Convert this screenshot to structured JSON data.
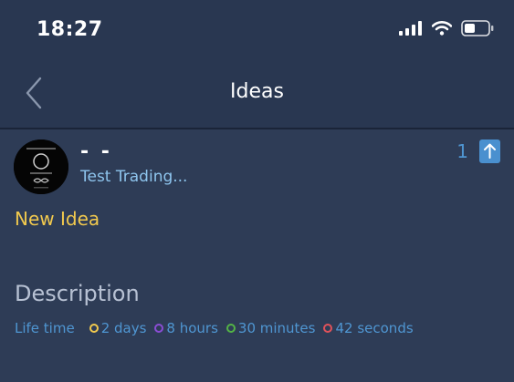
{
  "status_bar": {
    "time": "18:27",
    "icons": [
      "cellular-signal-icon",
      "wifi-icon",
      "battery-icon"
    ]
  },
  "nav": {
    "title": "Ideas",
    "back_icon": "chevron-left-icon"
  },
  "idea": {
    "author_name": "- -",
    "author_subtitle": "Test Trading...",
    "vote_count": "1",
    "upvote_icon": "arrow-up-icon",
    "title": "New Idea",
    "description_heading": "Description",
    "lifetime": {
      "label": "Life time",
      "segments": [
        {
          "value": "2 days",
          "color": "#f1c94e"
        },
        {
          "value": "8 hours",
          "color": "#8a4dd4"
        },
        {
          "value": "30 minutes",
          "color": "#53b346"
        },
        {
          "value": "42 seconds",
          "color": "#e0525a"
        }
      ]
    }
  },
  "colors": {
    "background": "#2e3c56",
    "header": "#293751",
    "accent_blue": "#4f96d2",
    "title_yellow": "#f1c94e"
  }
}
